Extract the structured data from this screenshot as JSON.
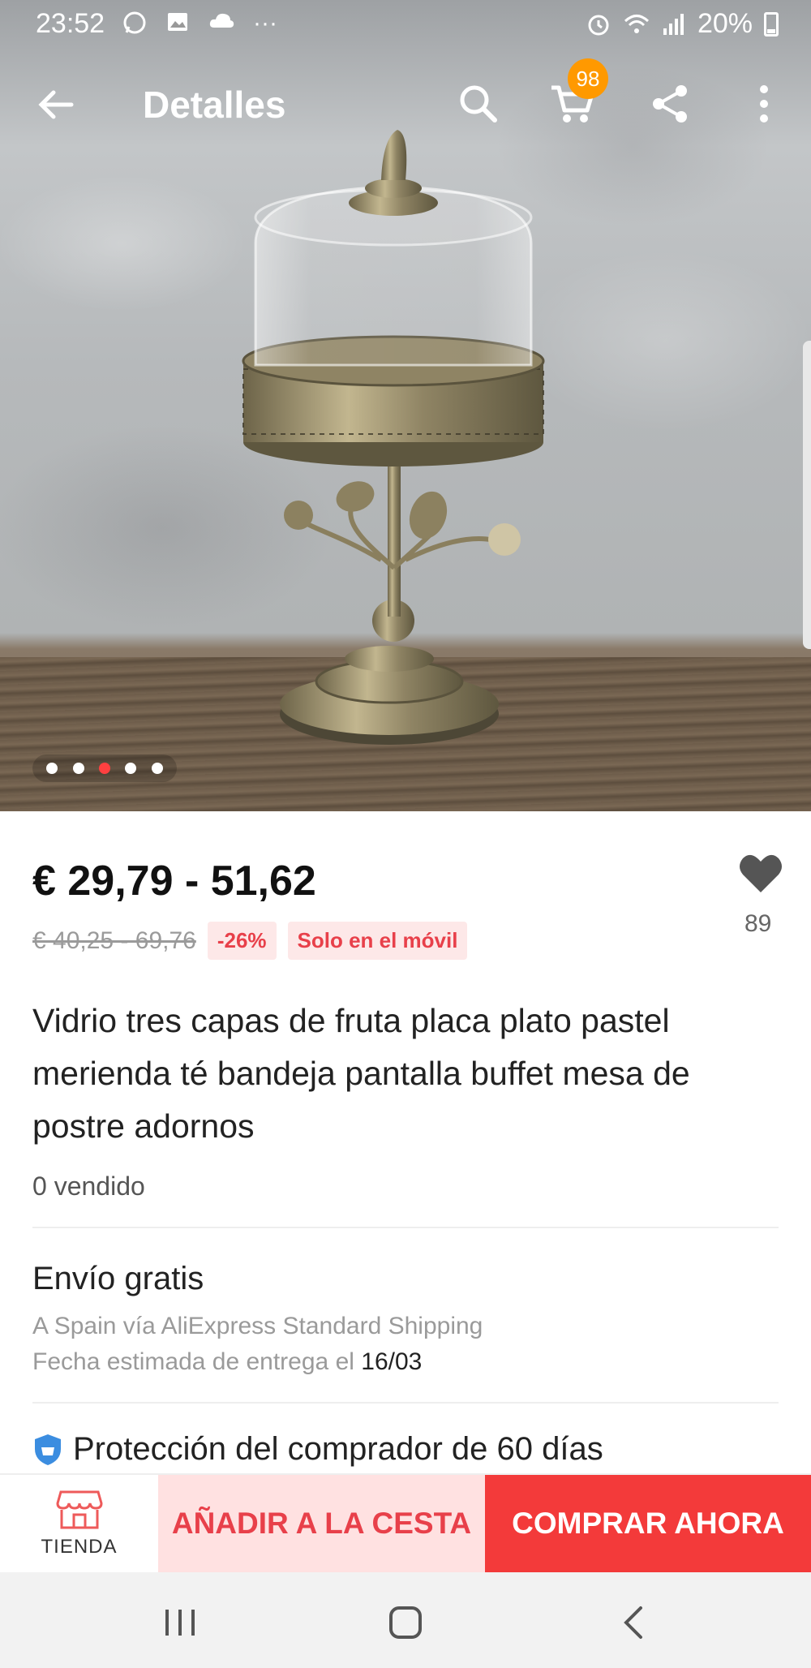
{
  "status_bar": {
    "time": "23:52",
    "left_icons": [
      "whatsapp-icon",
      "gallery-icon",
      "cloud-icon",
      "more-dots"
    ],
    "right_icons": [
      "alarm-icon",
      "wifi-icon",
      "signal-icon"
    ],
    "battery": "20%"
  },
  "header": {
    "title": "Detalles",
    "cart_count": "98",
    "actions": [
      "back-arrow-icon",
      "search-icon",
      "cart-icon",
      "share-icon",
      "more-vertical-icon"
    ]
  },
  "gallery": {
    "image_count": 5,
    "active_index": 2
  },
  "product": {
    "price": "€ 29,79 - 51,62",
    "original_price": "€ 40,25 - 69,76",
    "discount": "-26%",
    "mobile_badge": "Solo en el móvil",
    "wishlist_count": "89",
    "title": "Vidrio tres capas de fruta placa plato pastel merienda té bandeja pantalla buffet mesa de postre adornos",
    "sold": "0 vendido"
  },
  "shipping": {
    "title": "Envío gratis",
    "method": "A Spain vía AliExpress Standard Shipping",
    "delivery_prefix": "Fecha estimada de entrega el",
    "delivery_date": "16/03"
  },
  "protection": {
    "text": "Protección del comprador de 60 días"
  },
  "bottom_bar": {
    "store_label": "TIENDA",
    "add_to_cart": "AÑADIR A LA CESTA",
    "buy_now": "COMPRAR AHORA"
  },
  "colors": {
    "accent_red": "#f33a3a",
    "light_red": "#ffe1e1",
    "badge_orange": "#ff9900"
  }
}
